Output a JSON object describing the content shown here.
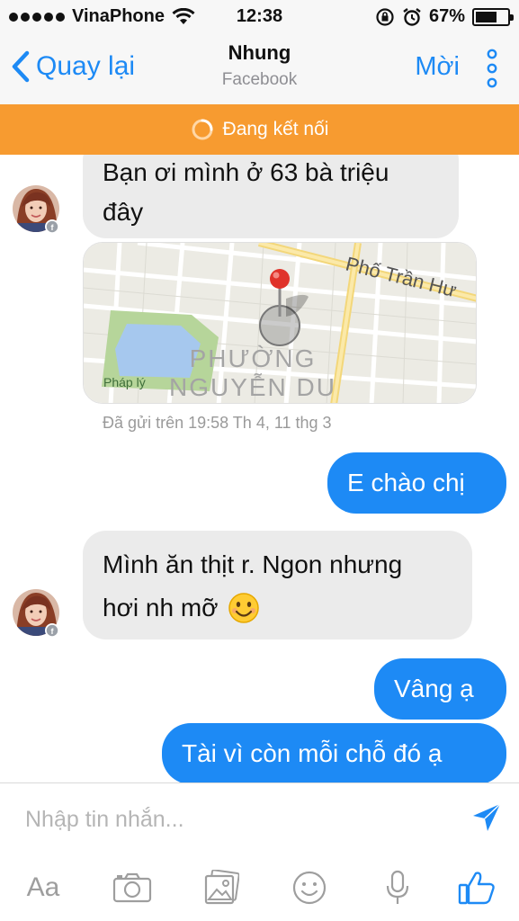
{
  "status_bar": {
    "carrier": "VinaPhone",
    "time": "12:38",
    "battery_percent": "67%",
    "battery_level": 0.67
  },
  "nav": {
    "back_label": "Quay lại",
    "title": "Nhung",
    "subtitle": "Facebook",
    "invite_label": "Mời"
  },
  "banner": {
    "text": "Đang kết nối"
  },
  "messages": [
    {
      "direction": "incoming",
      "lines": [
        "Bạn ơi mình ở 63 bà triệu",
        "đây"
      ]
    },
    {
      "direction": "incoming",
      "type": "map",
      "labels": {
        "street": "Phố Trần Hư",
        "district_line1": "PHƯỜNG",
        "district_line2": "NGUYỄN DU",
        "poi": "Pháp lý"
      }
    },
    {
      "direction": "meta",
      "timestamp": "Đã gửi trên 19:58 Th 4, 11 thg 3"
    },
    {
      "direction": "outgoing",
      "text": "E chào chị"
    },
    {
      "direction": "incoming",
      "lines": [
        "Mình ăn thịt r. Ngon nhưng",
        "hơi nh mỡ"
      ],
      "emoji": "smiling-face"
    },
    {
      "direction": "outgoing",
      "text": "Vâng ạ"
    },
    {
      "direction": "outgoing",
      "text": "Tài vì còn mỗi chỗ đó ạ"
    }
  ],
  "composer": {
    "placeholder": "Nhập tin nhắn...",
    "aa_label": "Aa",
    "tools": [
      "text-format-icon",
      "camera-icon",
      "photo-icon",
      "emoji-icon",
      "microphone-icon",
      "like-icon"
    ]
  },
  "colors": {
    "accent": "#1d8af5",
    "banner": "#f79b30",
    "incoming_bubble": "#ebebeb",
    "outgoing_bubble": "#1d8af5"
  }
}
